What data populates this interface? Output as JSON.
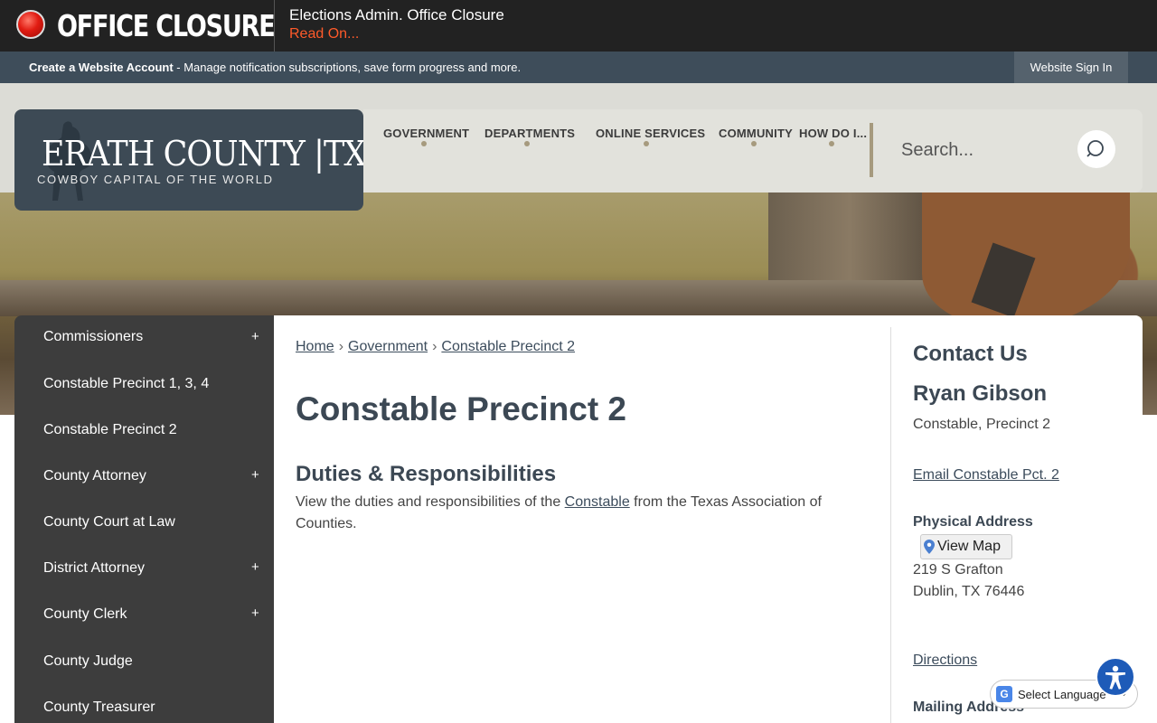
{
  "alert": {
    "title": "OFFICE CLOSURE",
    "message": "Elections Admin. Office Closure",
    "link": "Read On..."
  },
  "account_bar": {
    "create_account": "Create a Website Account",
    "description": " - Manage notification subscriptions, save form progress and more.",
    "sign_in": "Website Sign In"
  },
  "logo": {
    "name": "ERATH COUNTY |TX",
    "tagline": "COWBOY CAPITAL OF THE WORLD"
  },
  "nav": {
    "items": [
      "GOVERNMENT",
      "DEPARTMENTS",
      "ONLINE SERVICES",
      "COMMUNITY",
      "HOW DO I..."
    ]
  },
  "search": {
    "placeholder": "Search..."
  },
  "sidenav": {
    "items": [
      {
        "label": "Commissioners",
        "expand": "+"
      },
      {
        "label": "Constable Precinct 1, 3, 4",
        "expand": ""
      },
      {
        "label": "Constable Precinct 2",
        "expand": ""
      },
      {
        "label": "County Attorney",
        "expand": "+"
      },
      {
        "label": "County Court at Law",
        "expand": ""
      },
      {
        "label": "District Attorney",
        "expand": "+"
      },
      {
        "label": "County Clerk",
        "expand": "+"
      },
      {
        "label": "County Judge",
        "expand": ""
      },
      {
        "label": "County Treasurer",
        "expand": ""
      }
    ]
  },
  "breadcrumb": {
    "items": [
      "Home",
      "Government",
      "Constable Precinct 2"
    ],
    "separator": "›"
  },
  "page": {
    "title": "Constable Precinct 2",
    "section_heading": "Duties & Responsibilities",
    "body_before": "View the duties and responsibilities of the ",
    "body_link": "Constable",
    "body_after": " from the Texas Association of Counties."
  },
  "contact": {
    "heading": "Contact Us",
    "name": "Ryan Gibson",
    "role": "Constable, Precinct 2",
    "email_link": "Email Constable Pct. 2",
    "physical_heading": "Physical Address",
    "view_map": "View Map",
    "address_line1": "219 S Grafton",
    "address_line2": "Dublin, TX 76446",
    "directions": "Directions",
    "mailing_heading": "Mailing Address"
  },
  "translate": {
    "label": "Select Language",
    "icon": "google-translate-icon"
  },
  "colors": {
    "alert_bg": "#222222",
    "alert_link": "#ff5a2a",
    "account_bar": "#3e4d5a",
    "sidenav_bg": "#3d3d3d",
    "heading": "#3c4854",
    "accent_dot": "#a69a7e"
  }
}
